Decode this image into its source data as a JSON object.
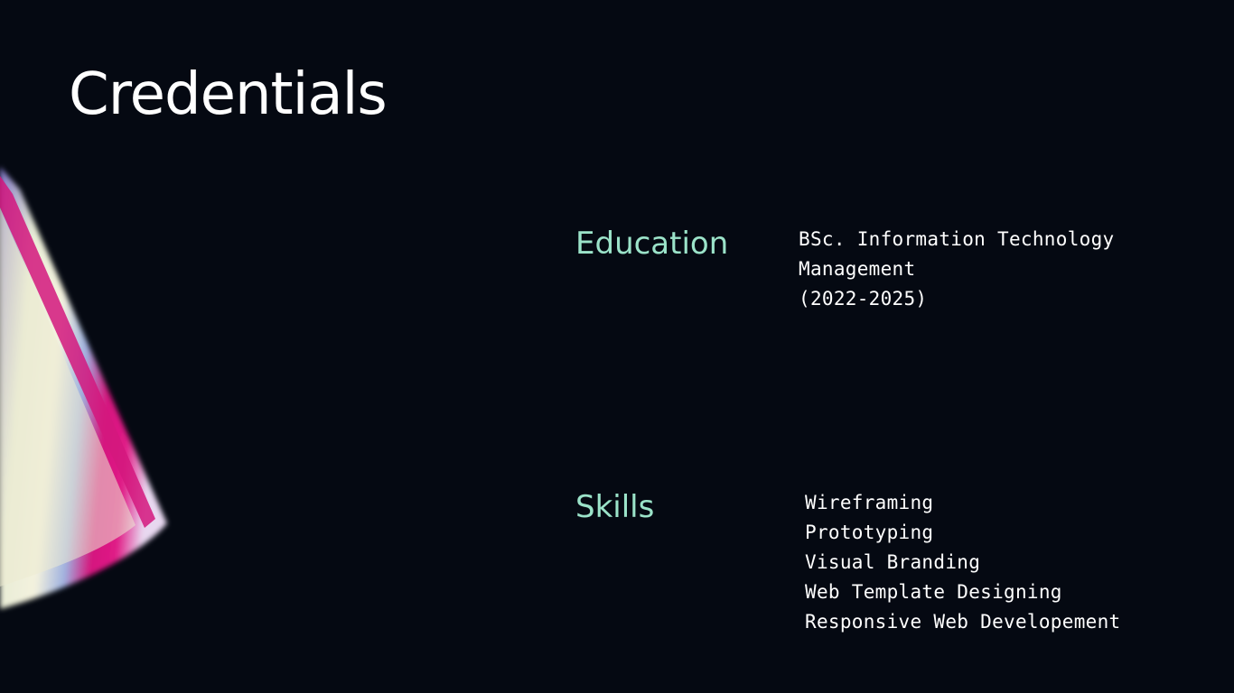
{
  "slide": {
    "title": "Credentials",
    "accent_color": "#9be3c9",
    "background_color": "#050912"
  },
  "decoration": {
    "icon": "gradient-cone-shape",
    "colors": [
      "#d4187e",
      "#f3f0d8",
      "#8fa0d8",
      "#6a5da8"
    ]
  },
  "education": {
    "label": "Education",
    "lines": [
      "BSc. Information Technology",
      "Management",
      "(2022-2025)"
    ]
  },
  "skills": {
    "label": "Skills",
    "items": [
      "Wireframing",
      "Prototyping",
      "Visual Branding",
      "Web Template Designing",
      "Responsive Web Developement"
    ]
  }
}
